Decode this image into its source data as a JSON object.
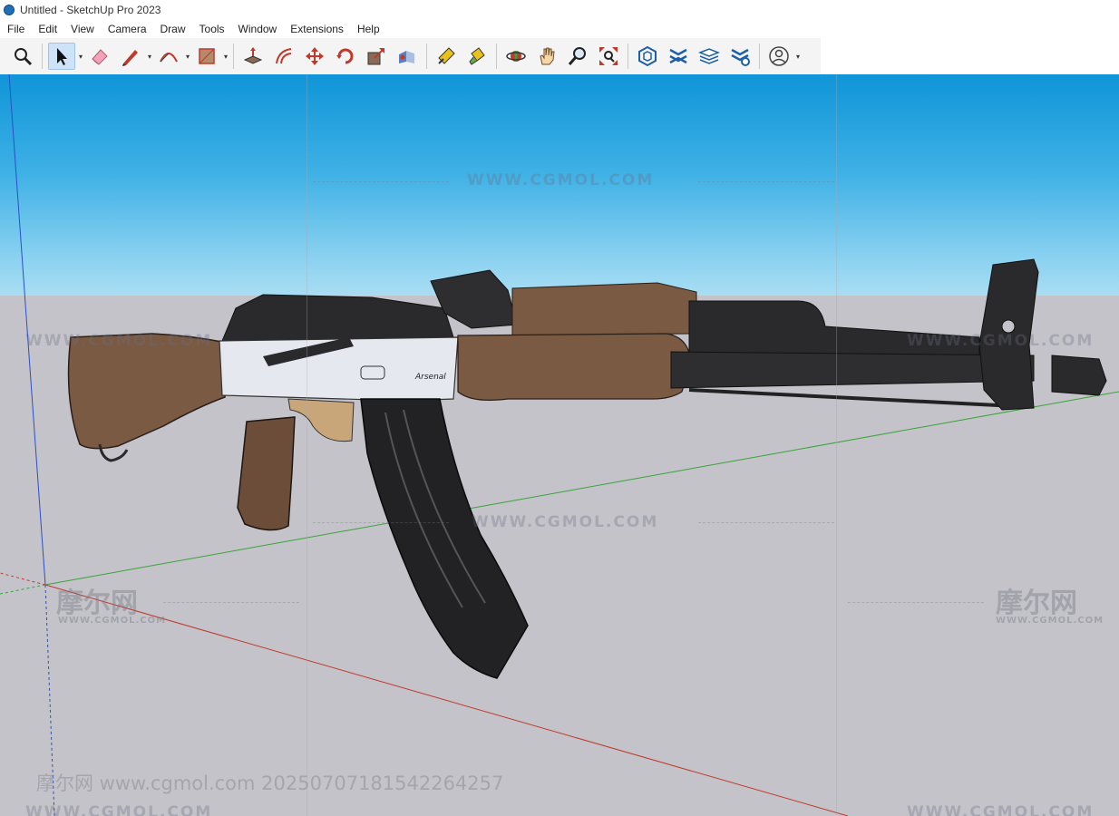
{
  "window": {
    "title": "Untitled - SketchUp Pro 2023"
  },
  "menu": {
    "items": [
      "File",
      "Edit",
      "View",
      "Camera",
      "Draw",
      "Tools",
      "Window",
      "Extensions",
      "Help"
    ]
  },
  "toolbar": {
    "tools": [
      "search-icon",
      "select-arrow-icon",
      "eraser-icon",
      "pencil-line-icon",
      "arc-icon",
      "rectangle-icon",
      "push-pull-icon",
      "offset-icon",
      "move-icon",
      "rotate-icon",
      "scale-icon",
      "follow-me-icon",
      "tape-measure-icon",
      "paint-bucket-icon",
      "orbit-icon",
      "pan-hand-icon",
      "zoom-icon",
      "zoom-extents-icon",
      "warehouse-icon",
      "components-icon",
      "layers-icon",
      "extension-settings-icon",
      "account-icon"
    ]
  },
  "viewport": {
    "sky_color": "#2aa7e2",
    "ground_color": "#c3c3c9",
    "model": "rifle-3d-model",
    "model_labels": {
      "receiver_marking": "Arsenal"
    },
    "watermarks": {
      "url": "WWW.CGMOL.COM",
      "logo": "摩尔网",
      "logo_sub": "WWW.CGMOL.COM",
      "footer": "摩尔网 www.cgmol.com 20250707181542264257"
    }
  },
  "colors": {
    "axis_red": "#c0392b",
    "axis_green": "#3aa33a",
    "axis_blue": "#2b4fc9",
    "wood": "#7a5a43",
    "metal": "#2a2a2c",
    "receiver": "#e6e8f0"
  }
}
